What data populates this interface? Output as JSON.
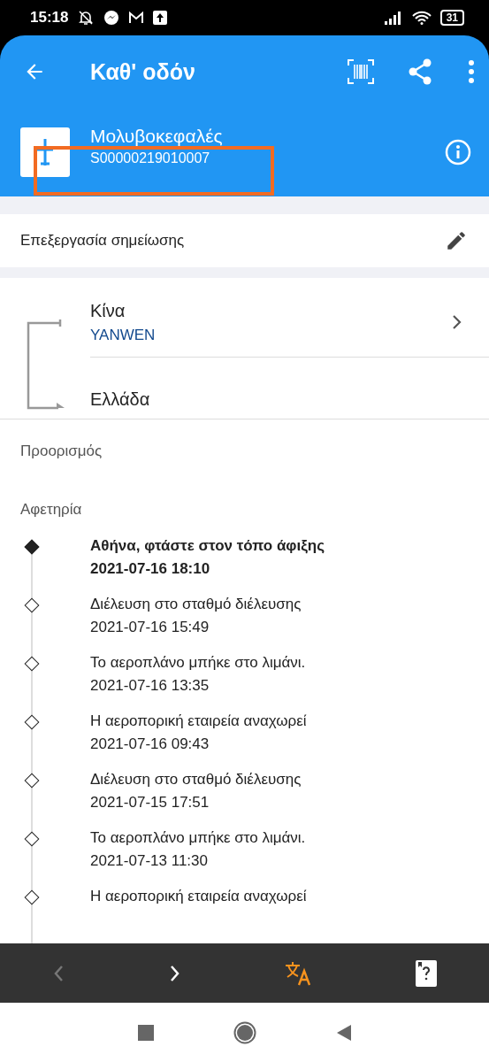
{
  "status_bar": {
    "time": "15:18",
    "battery": "31"
  },
  "app_bar": {
    "title": "Καθ' οδόν"
  },
  "parcel": {
    "name": "Μολυβοκεφαλές",
    "tracking_number": "S00000219010007"
  },
  "note": {
    "label": "Επεξεργασία σημείωσης"
  },
  "route": {
    "origin": "Κίνα",
    "carrier": "YANWEN",
    "destination": "Ελλάδα"
  },
  "labels": {
    "destination": "Προορισμός",
    "origin": "Αφετηρία"
  },
  "events": [
    {
      "text": "Αθήνα, φτάστε στον τόπο άφιξης",
      "time": "2021-07-16 18:10",
      "selected": true
    },
    {
      "text": "Διέλευση στο σταθμό διέλευσης",
      "time": "2021-07-16 15:49",
      "selected": false
    },
    {
      "text": "Το αεροπλάνο μπήκε στο λιμάνι.",
      "time": "2021-07-16 13:35",
      "selected": false
    },
    {
      "text": "Η αεροπορική εταιρεία αναχωρεί",
      "time": "2021-07-16 09:43",
      "selected": false
    },
    {
      "text": "Διέλευση στο σταθμό διέλευσης",
      "time": "2021-07-15 17:51",
      "selected": false
    },
    {
      "text": "Το αεροπλάνο μπήκε στο λιμάνι.",
      "time": "2021-07-13 11:30",
      "selected": false
    },
    {
      "text": "Η αεροπορική εταιρεία αναχωρεί",
      "selected": false
    }
  ],
  "bottom_bar": {
    "prev": {
      "disabled": true
    },
    "next": {
      "disabled": false
    }
  }
}
